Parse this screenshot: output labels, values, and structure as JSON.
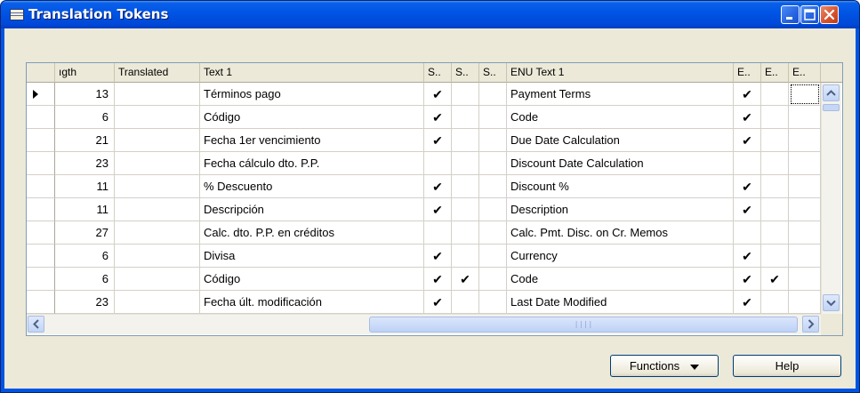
{
  "window": {
    "title": "Translation Tokens"
  },
  "columns": [
    "ıgth",
    "Translated",
    "Text 1",
    "S..",
    "S..",
    "S..",
    "ENU Text 1",
    "E..",
    "E..",
    "E.."
  ],
  "rows": [
    {
      "length": "13",
      "translated": "",
      "text1": "Términos pago",
      "s1": "✔",
      "s2": "",
      "s3": "",
      "enu": "Payment Terms",
      "e1": "✔",
      "e2": "",
      "e3": ""
    },
    {
      "length": "6",
      "translated": "",
      "text1": "Código",
      "s1": "✔",
      "s2": "",
      "s3": "",
      "enu": "Code",
      "e1": "✔",
      "e2": "",
      "e3": ""
    },
    {
      "length": "21",
      "translated": "",
      "text1": "Fecha 1er vencimiento",
      "s1": "✔",
      "s2": "",
      "s3": "",
      "enu": "Due Date Calculation",
      "e1": "✔",
      "e2": "",
      "e3": ""
    },
    {
      "length": "23",
      "translated": "",
      "text1": "Fecha cálculo dto. P.P.",
      "s1": "",
      "s2": "",
      "s3": "",
      "enu": "Discount Date Calculation",
      "e1": "",
      "e2": "",
      "e3": ""
    },
    {
      "length": "11",
      "translated": "",
      "text1": "% Descuento",
      "s1": "✔",
      "s2": "",
      "s3": "",
      "enu": "Discount %",
      "e1": "✔",
      "e2": "",
      "e3": ""
    },
    {
      "length": "11",
      "translated": "",
      "text1": "Descripción",
      "s1": "✔",
      "s2": "",
      "s3": "",
      "enu": "Description",
      "e1": "✔",
      "e2": "",
      "e3": ""
    },
    {
      "length": "27",
      "translated": "",
      "text1": "Calc. dto. P.P. en créditos",
      "s1": "",
      "s2": "",
      "s3": "",
      "enu": "Calc. Pmt. Disc. on Cr. Memos",
      "e1": "",
      "e2": "",
      "e3": ""
    },
    {
      "length": "6",
      "translated": "",
      "text1": "Divisa",
      "s1": "✔",
      "s2": "",
      "s3": "",
      "enu": "Currency",
      "e1": "✔",
      "e2": "",
      "e3": ""
    },
    {
      "length": "6",
      "translated": "",
      "text1": "Código",
      "s1": "✔",
      "s2": "✔",
      "s3": "",
      "enu": "Code",
      "e1": "✔",
      "e2": "✔",
      "e3": ""
    },
    {
      "length": "23",
      "translated": "",
      "text1": "Fecha últ. modificación",
      "s1": "✔",
      "s2": "",
      "s3": "",
      "enu": "Last Date Modified",
      "e1": "✔",
      "e2": "",
      "e3": ""
    }
  ],
  "buttons": {
    "functions": "Functions",
    "help": "Help"
  },
  "icons": {
    "minimize": "minimize-icon",
    "maximize": "maximize-icon",
    "close": "close-icon",
    "app": "table-icon"
  }
}
